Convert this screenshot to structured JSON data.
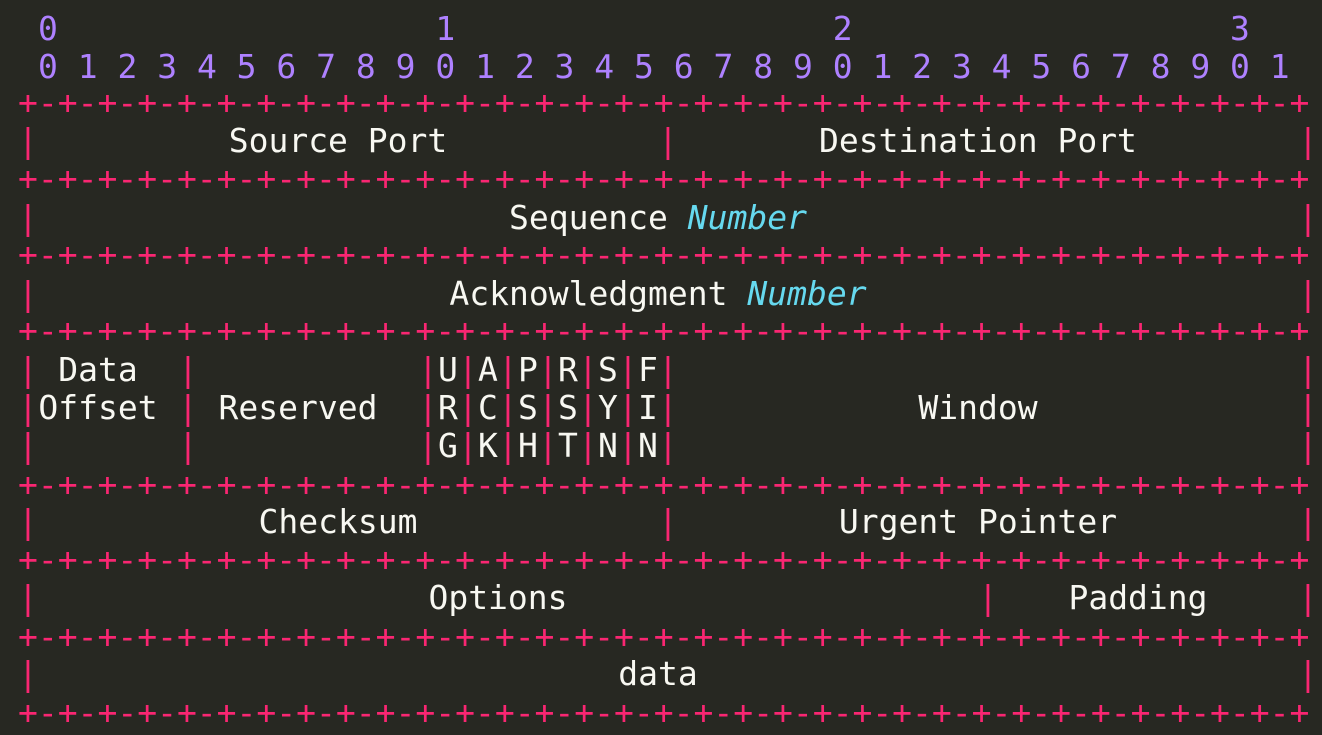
{
  "colors": {
    "background": "#272822",
    "ruler": "#AE81FF",
    "border": "#F92672",
    "text": "#F8F8F2",
    "keyword": "#66D9EF"
  },
  "ruler": {
    "tens": "0                   1                   2                   3",
    "units": "0 1 2 3 4 5 6 7 8 9 0 1 2 3 4 5 6 7 8 9 0 1 2 3 4 5 6 7 8 9 0 1"
  },
  "header": {
    "source_port": "Source Port",
    "destination_port": "Destination Port",
    "sequence": {
      "prefix": "Sequence",
      "keyword": "Number"
    },
    "acknowledgment": {
      "prefix": "Acknowledgment",
      "keyword": "Number"
    },
    "data_offset": [
      "Data",
      "Offset"
    ],
    "reserved": "Reserved",
    "flags": [
      [
        "U",
        "R",
        "G"
      ],
      [
        "A",
        "C",
        "K"
      ],
      [
        "P",
        "S",
        "H"
      ],
      [
        "R",
        "S",
        "T"
      ],
      [
        "S",
        "Y",
        "N"
      ],
      [
        "F",
        "I",
        "N"
      ]
    ],
    "window": "Window",
    "checksum": "Checksum",
    "urgent_pointer": "Urgent Pointer",
    "options": "Options",
    "padding": "Padding",
    "data": "data"
  }
}
